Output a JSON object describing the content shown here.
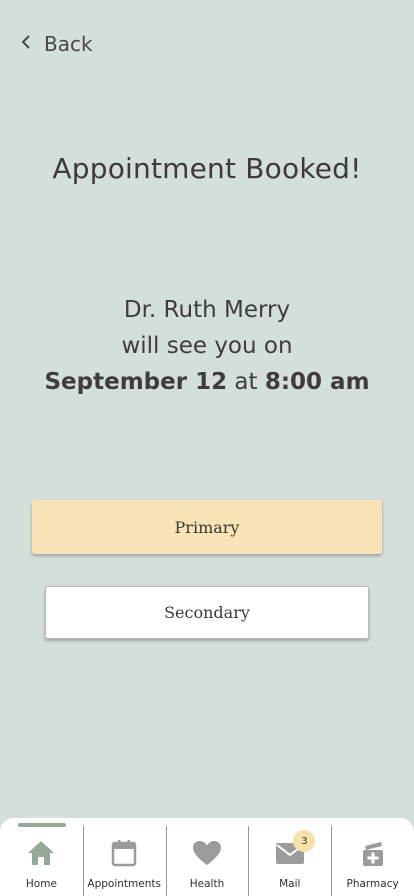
{
  "header": {
    "back_label": "Back"
  },
  "title": "Appointment Booked!",
  "confirmation": {
    "doctor": "Dr. Ruth Merry",
    "line2": "will see you on",
    "date": "September 12",
    "connector": "at",
    "time": "8:00 am"
  },
  "buttons": {
    "primary_label": "Primary",
    "secondary_label": "Secondary"
  },
  "colors": {
    "background": "#d5dfd9",
    "primary_button": "#f7e3b6",
    "active_tab_icon": "#94aa96",
    "inactive_tab_icon": "#9b9b9b",
    "badge": "#f6e1a8"
  },
  "tabbar": {
    "active": "Home",
    "tabs": [
      {
        "label": "Home",
        "icon": "home-icon"
      },
      {
        "label": "Appointments",
        "icon": "calendar-icon"
      },
      {
        "label": "Health",
        "icon": "heart-icon"
      },
      {
        "label": "Mail",
        "icon": "mail-icon",
        "badge": "3"
      },
      {
        "label": "Pharmacy",
        "icon": "pharmacy-icon"
      }
    ]
  }
}
